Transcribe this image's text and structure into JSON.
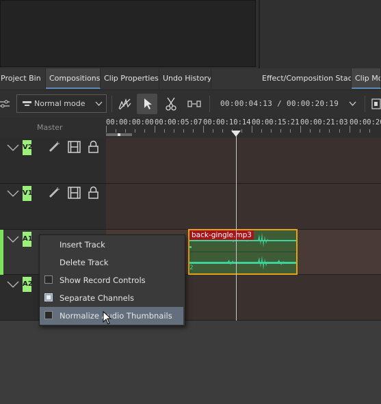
{
  "tabs": [
    {
      "label": "Project Bin",
      "active": false
    },
    {
      "label": "Compositions",
      "active": true
    },
    {
      "label": "Clip Properties",
      "active": false
    },
    {
      "label": "Undo History",
      "active": false
    },
    {
      "label": "Effect/Composition Stack",
      "active": false
    },
    {
      "label": "Clip Mo",
      "active": true
    }
  ],
  "toolbar": {
    "mode_label": "Normal mode",
    "timecode_current": "00:00:04:13",
    "timecode_separator": "/",
    "timecode_total": "00:00:20:19"
  },
  "ruler": {
    "master_label": "Master",
    "ticks": [
      "00:00:00:00",
      "00:00:05:07",
      "00:00:10:14",
      "00:00:15:21",
      "00:00:21:03",
      "00:00:26"
    ]
  },
  "tracks": [
    {
      "name": "V2",
      "type": "video"
    },
    {
      "name": "V1",
      "type": "video"
    },
    {
      "name": "A1",
      "type": "audio"
    },
    {
      "name": "A2",
      "type": "audio"
    }
  ],
  "clip": {
    "label": "back-gingle.mp3",
    "channel_marker": "2"
  },
  "context_menu": {
    "items": [
      {
        "label": "Insert Track",
        "checkbox": false,
        "checked": false
      },
      {
        "label": "Delete Track",
        "checkbox": false,
        "checked": false
      },
      {
        "label": "Show Record Controls",
        "checkbox": true,
        "checked": false
      },
      {
        "label": "Separate Channels",
        "checkbox": true,
        "checked": true
      },
      {
        "label": "Normalize Audio Thumbnails",
        "checkbox": true,
        "checked": false,
        "highlighted": true
      }
    ]
  },
  "colors": {
    "track_badge": "#9bf07c",
    "clip_border": "#e3a41a",
    "clip_label_bg": "#a8131a",
    "waveform": "#3fd19a",
    "menu_highlight": "#636f7d"
  }
}
